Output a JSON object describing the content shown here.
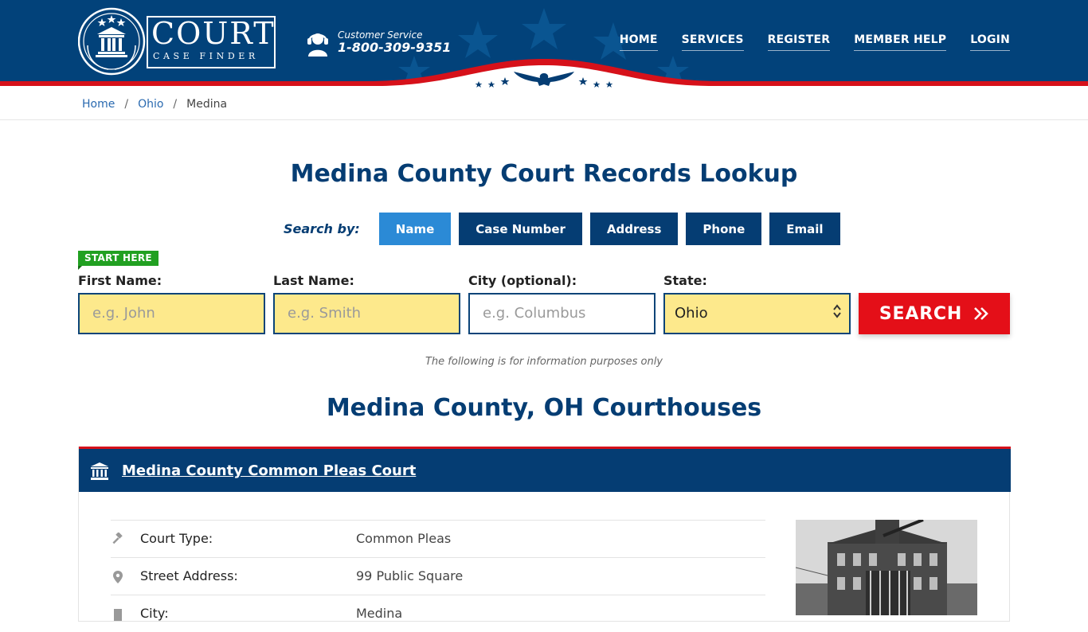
{
  "brand": {
    "name": "COURT",
    "tagline": "CASE FINDER"
  },
  "customer_service": {
    "label": "Customer Service",
    "phone": "1-800-309-9351"
  },
  "nav": [
    {
      "label": "HOME"
    },
    {
      "label": "SERVICES"
    },
    {
      "label": "REGISTER"
    },
    {
      "label": "MEMBER HELP"
    },
    {
      "label": "LOGIN"
    }
  ],
  "breadcrumb": {
    "items": [
      "Home",
      "Ohio"
    ],
    "current": "Medina",
    "separator": "/"
  },
  "page_title": "Medina County Court Records Lookup",
  "search_by": {
    "label": "Search by:",
    "options": [
      {
        "label": "Name",
        "active": true
      },
      {
        "label": "Case Number",
        "active": false
      },
      {
        "label": "Address",
        "active": false
      },
      {
        "label": "Phone",
        "active": false
      },
      {
        "label": "Email",
        "active": false
      }
    ]
  },
  "start_here": "START HERE",
  "form": {
    "first_name": {
      "label": "First Name:",
      "placeholder": "e.g. John"
    },
    "last_name": {
      "label": "Last Name:",
      "placeholder": "e.g. Smith"
    },
    "city": {
      "label": "City (optional):",
      "placeholder": "e.g.  Columbus"
    },
    "state": {
      "label": "State:",
      "value": "Ohio"
    },
    "submit": "SEARCH"
  },
  "disclaimer": "The following is for information purposes only",
  "section_title": "Medina County, OH Courthouses",
  "courthouse": {
    "name": "Medina County Common Pleas Court",
    "rows": [
      {
        "label": "Court Type:",
        "value": "Common Pleas",
        "icon": "gavel-icon"
      },
      {
        "label": "Street Address:",
        "value": "99 Public Square",
        "icon": "map-pin-icon"
      },
      {
        "label": "City:",
        "value": "Medina",
        "icon": "city-icon"
      }
    ]
  },
  "colors": {
    "navy": "#053d73",
    "header": "#02427a",
    "red": "#e40f18",
    "active_blue": "#2b8ad6",
    "field_yellow": "#fde98c",
    "green": "#21a021"
  }
}
